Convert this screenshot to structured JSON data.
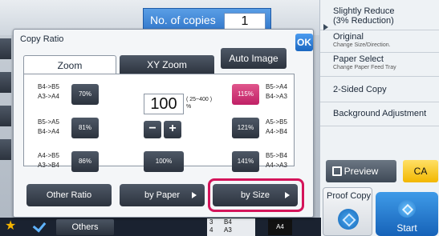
{
  "header": {
    "copies_label": "No. of copies",
    "copies_value": "1"
  },
  "right_panel": {
    "items": [
      {
        "main": "Slightly Reduce",
        "sub": "(3% Reduction)"
      },
      {
        "main": "Original",
        "sub": "Change Size/Direction."
      },
      {
        "main": "Paper Select",
        "sub": "Change Paper Feed Tray"
      },
      {
        "main": "2-Sided Copy",
        "sub": ""
      },
      {
        "main": "Background Adjustment",
        "sub": ""
      }
    ],
    "preview_label": "Preview",
    "ca_label": "CA",
    "proof_copy_label": "Proof Copy",
    "start_label": "Start"
  },
  "dialog": {
    "title": "Copy Ratio",
    "ok_label": "OK",
    "tabs": [
      {
        "label": "Zoom",
        "active": true
      },
      {
        "label": "XY Zoom",
        "active": false
      }
    ],
    "auto_image_label": "Auto Image",
    "presets_left": [
      {
        "label_line1": "B4->B5",
        "label_line2": "A3->A4",
        "value": "70%"
      },
      {
        "label_line1": "B5->A5",
        "label_line2": "B4->A4",
        "value": "81%"
      },
      {
        "label_line1": "A4->B5",
        "label_line2": "A3->B4",
        "value": "86%"
      }
    ],
    "presets_right": [
      {
        "label_line1": "B5->A4",
        "label_line2": "B4->A3",
        "value": "115%"
      },
      {
        "label_line1": "A5->B5",
        "label_line2": "A4->B4",
        "value": "121%"
      },
      {
        "label_line1": "B5->B4",
        "label_line2": "A4->A3",
        "value": "141%"
      }
    ],
    "zoom_value": "100",
    "zoom_range_line1": "( 25~400 )",
    "zoom_range_line2": "%",
    "minus_label": "−",
    "plus_label": "+",
    "reset_label": "100%",
    "other_ratio_label": "Other Ratio",
    "by_paper_label": "by Paper",
    "by_size_label": "by Size"
  },
  "bottom_bar": {
    "others_label": "Others",
    "tray_rows": [
      {
        "num": "3",
        "size": "B4"
      },
      {
        "num": "4",
        "size": "A3"
      }
    ],
    "paper_size": "A4"
  },
  "colors": {
    "accent_pink": "#c02066",
    "highlight": "#d4145a",
    "blue": "#1b67c0",
    "ca_yellow": "#f2b700"
  }
}
